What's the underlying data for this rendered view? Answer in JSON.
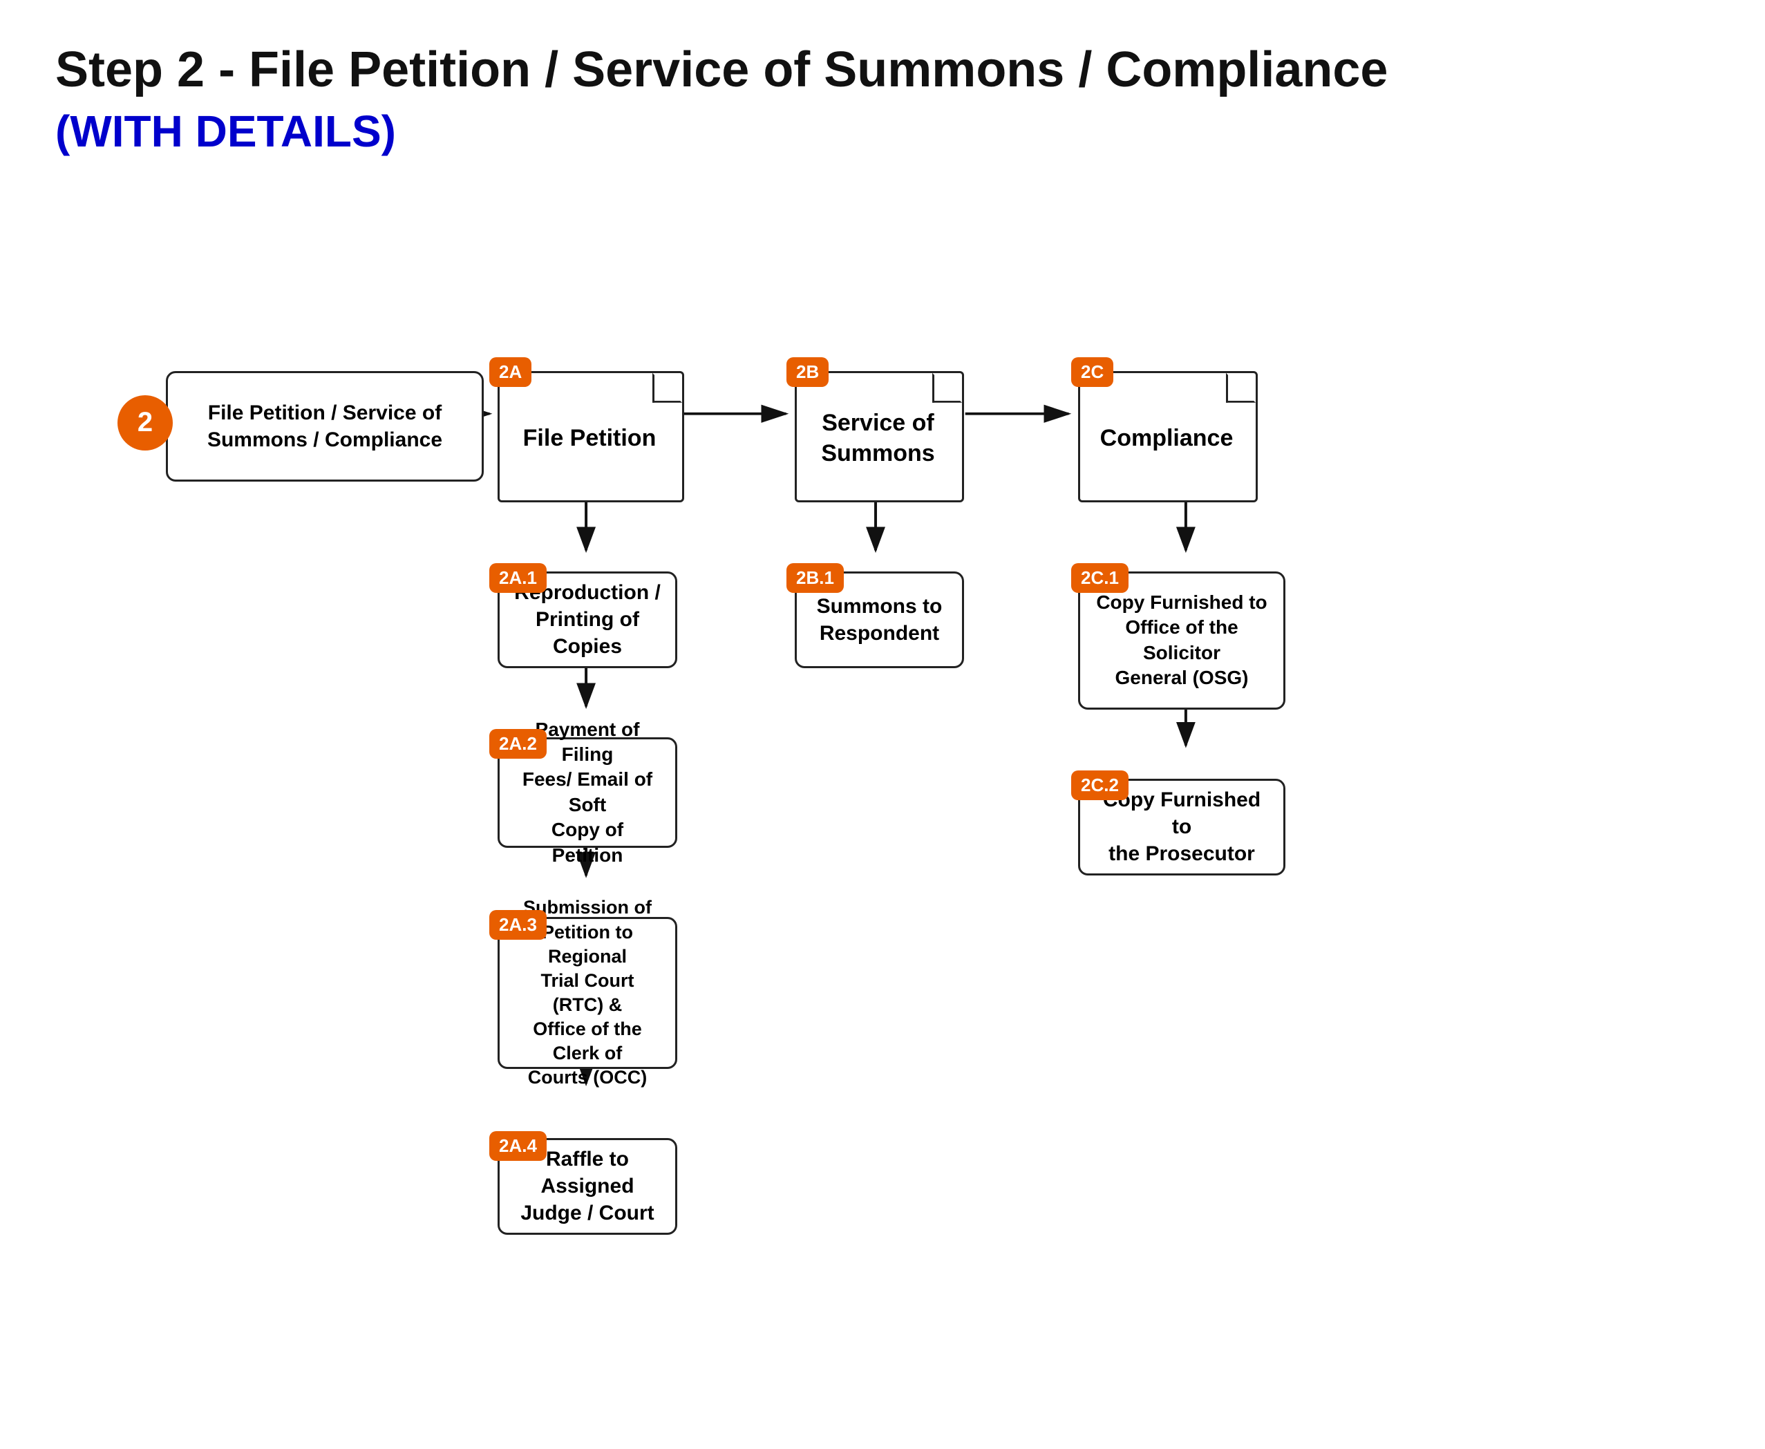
{
  "header": {
    "title": "Step 2 - File Petition / Service of Summons / Compliance",
    "subtitle": "(WITH DETAILS)"
  },
  "nodes": {
    "main": {
      "badge": "2",
      "label": "File Petition / Service of\nSummons / Compliance"
    },
    "n2a": {
      "badge": "2A",
      "label": "File Petition"
    },
    "n2b": {
      "badge": "2B",
      "label": "Service of\nSummons"
    },
    "n2c": {
      "badge": "2C",
      "label": "Compliance"
    },
    "n2a1": {
      "badge": "2A.1",
      "label": "Reproduction /\nPrinting of Copies"
    },
    "n2a2": {
      "badge": "2A.2",
      "label": "Payment of Filing\nFees/ Email of Soft\nCopy of Petition"
    },
    "n2a3": {
      "badge": "2A.3",
      "label": "Submission of\nPetition to Regional\nTrial Court (RTC) &\nOffice of the Clerk of\nCourts (OCC)"
    },
    "n2a4": {
      "badge": "2A.4",
      "label": "Raffle to Assigned\nJudge / Court"
    },
    "n2b1": {
      "badge": "2B.1",
      "label": "Summons to\nRespondent"
    },
    "n2c1": {
      "badge": "2C.1",
      "label": "Copy Furnished to\nOffice of the Solicitor\nGeneral (OSG)"
    },
    "n2c2": {
      "badge": "2C.2",
      "label": "Copy Furnished to\nthe Prosecutor"
    }
  }
}
